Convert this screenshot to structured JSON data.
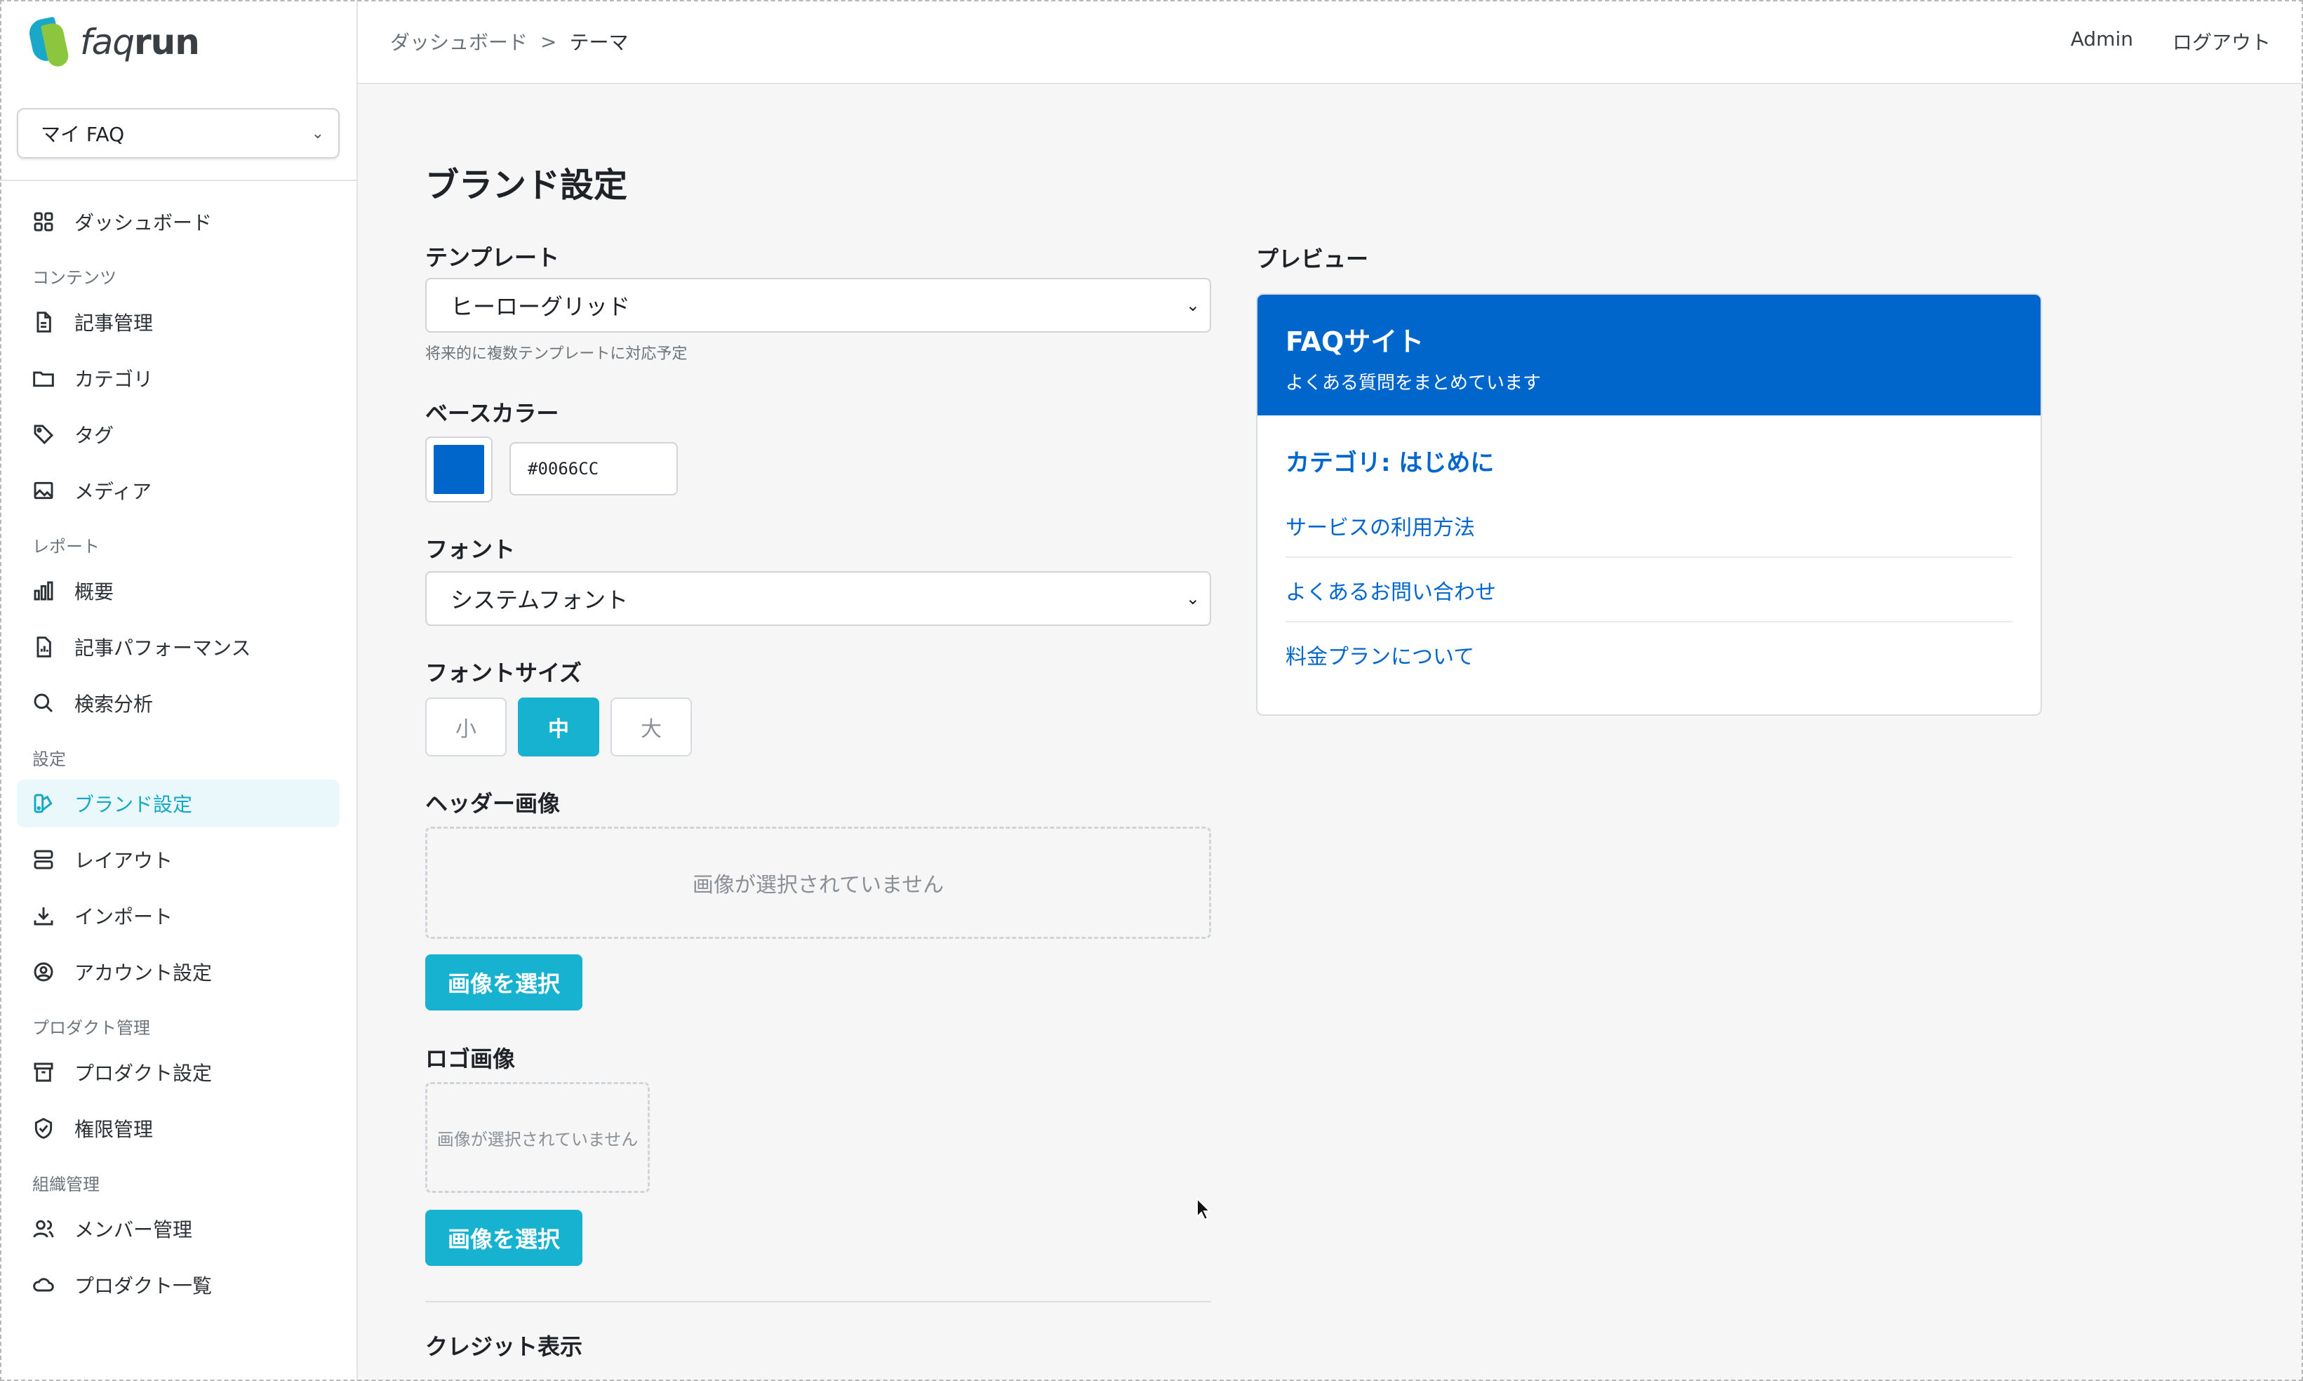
{
  "brand": {
    "logo_text_bold": "faq",
    "logo_text_italic": "run"
  },
  "project_select": {
    "value": "マイ FAQ"
  },
  "sidebar": {
    "dashboard": "ダッシュボード",
    "section_content": "コンテンツ",
    "articles": "記事管理",
    "categories": "カテゴリ",
    "tags": "タグ",
    "media": "メディア",
    "section_reports": "レポート",
    "overview": "概要",
    "article_performance": "記事パフォーマンス",
    "search_analysis": "検索分析",
    "section_settings": "設定",
    "brand_settings": "ブランド設定",
    "layout": "レイアウト",
    "import": "インポート",
    "account_settings": "アカウント設定",
    "section_product": "プロダクト管理",
    "product_settings": "プロダクト設定",
    "permissions": "権限管理",
    "section_org": "組織管理",
    "members": "メンバー管理",
    "product_list": "プロダクト一覧"
  },
  "topbar": {
    "breadcrumb_root": "ダッシュボード",
    "breadcrumb_sep": ">",
    "breadcrumb_current": "テーマ",
    "user": "Admin",
    "logout": "ログアウト"
  },
  "page": {
    "title": "ブランド設定",
    "template_label": "テンプレート",
    "template_value": "ヒーローグリッド",
    "template_hint": "将来的に複数テンプレートに対応予定",
    "base_color_label": "ベースカラー",
    "base_color_value": "#0066CC",
    "font_label": "フォント",
    "font_value": "システムフォント",
    "font_size_label": "フォントサイズ",
    "font_sizes": [
      "小",
      "中",
      "大"
    ],
    "font_size_selected": "中",
    "header_image_label": "ヘッダー画像",
    "no_image_text": "画像が選択されていません",
    "select_image_button": "画像を選択",
    "logo_image_label": "ロゴ画像",
    "credit_label": "クレジット表示"
  },
  "preview": {
    "label": "プレビュー",
    "site_title": "FAQサイト",
    "site_subtitle": "よくある質問をまとめています",
    "category_heading": "カテゴリ: はじめに",
    "links": [
      "サービスの利用方法",
      "よくあるお問い合わせ",
      "料金プランについて"
    ]
  },
  "colors": {
    "accent": "#17B2CF",
    "brand_blue": "#0066CC"
  }
}
